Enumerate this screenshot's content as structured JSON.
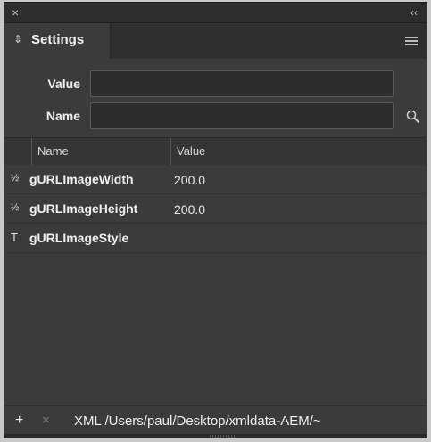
{
  "titlebar": {
    "close_glyph": "×",
    "collapse_glyph": "‹‹"
  },
  "panel": {
    "tab_label": "Settings",
    "tab_icon": "⇕ sort-icon",
    "menu_icon": "hamburger-menu-icon"
  },
  "form": {
    "value_label": "Value",
    "value_input": "",
    "name_label": "Name",
    "name_input": "",
    "search_icon": "magnifier-icon"
  },
  "table": {
    "columns": [
      "Name",
      "Value"
    ],
    "rows": [
      {
        "type": "½",
        "name": "gURLImageWidth",
        "value": "200.0"
      },
      {
        "type": "½",
        "name": "gURLImageHeight",
        "value": "200.0"
      },
      {
        "type": "T",
        "name": "gURLImageStyle",
        "value": ""
      }
    ]
  },
  "statusbar": {
    "add_glyph": "+",
    "delete_glyph": "×",
    "path": "XML /Users/paul/Desktop/xmldata-AEM/~"
  }
}
